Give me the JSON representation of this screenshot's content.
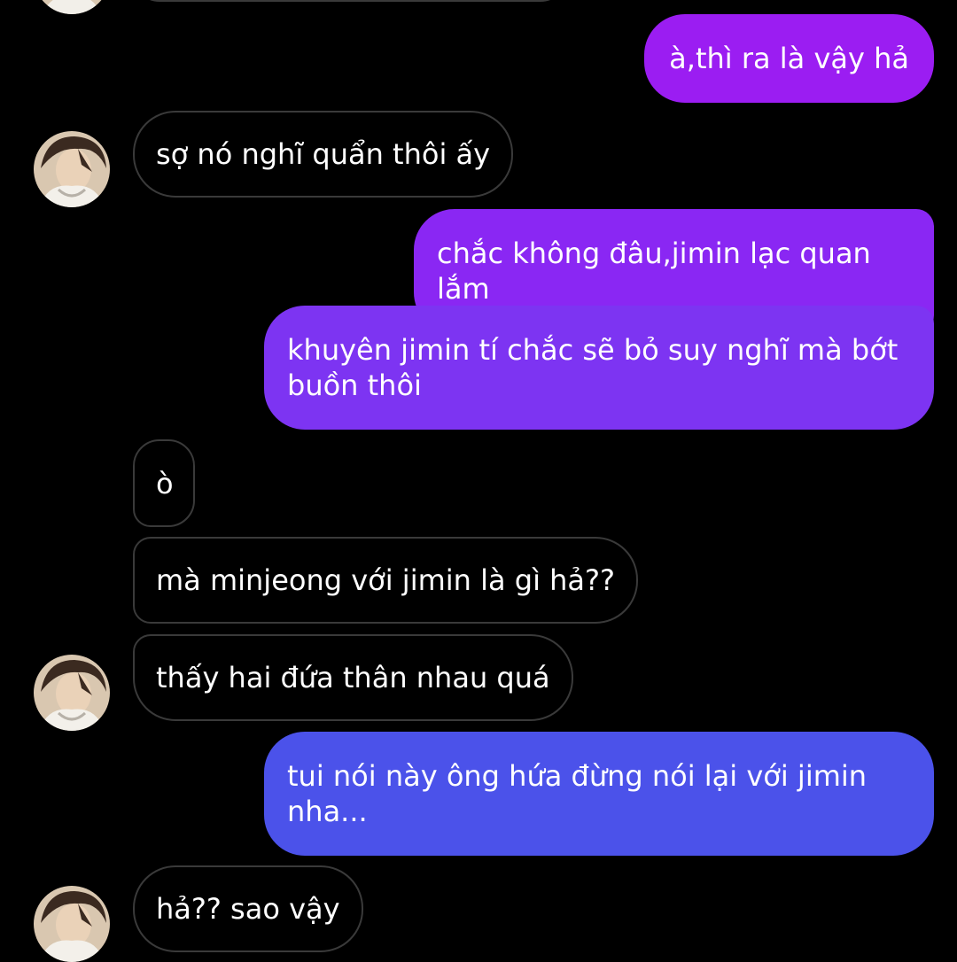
{
  "colors": {
    "background": "#000000",
    "incoming_border": "#3a3a3a",
    "outgoing_top": "#9b1df2",
    "outgoing_mid": "#7c3bf0",
    "outgoing_bottom": "#4b52ea",
    "text": "#ffffff"
  },
  "avatar_icon": "user-avatar-photo",
  "messages": [
    {
      "id": "m1",
      "sender": "me",
      "text": "à,thì ra là vậy hả"
    },
    {
      "id": "m2",
      "sender": "other",
      "text": "sợ nó nghĩ quẩn thôi ấy"
    },
    {
      "id": "m3",
      "sender": "me",
      "text": "chắc không đâu,jimin lạc quan lắm"
    },
    {
      "id": "m4",
      "sender": "me",
      "text": "khuyên jimin tí chắc sẽ bỏ suy nghĩ mà bớt buồn thôi"
    },
    {
      "id": "m5",
      "sender": "other",
      "text": "ò"
    },
    {
      "id": "m6",
      "sender": "other",
      "text": "mà minjeong với jimin là gì hả??"
    },
    {
      "id": "m7",
      "sender": "other",
      "text": "thấy hai đứa thân nhau quá"
    },
    {
      "id": "m8",
      "sender": "me",
      "text": "tui nói này ông hứa đừng nói lại với jimin nha..."
    },
    {
      "id": "m9",
      "sender": "other",
      "text": "hả?? sao vậy"
    }
  ]
}
